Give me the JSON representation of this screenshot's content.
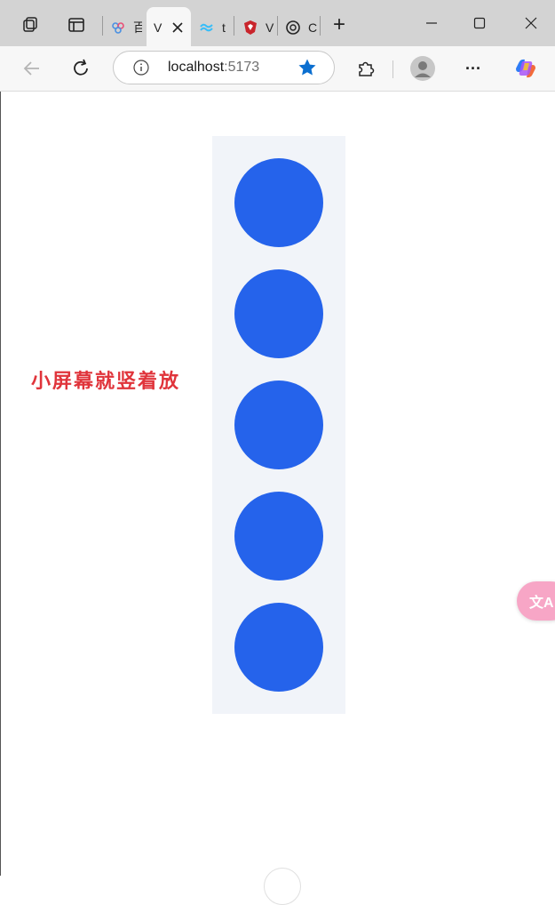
{
  "browser": {
    "tabs": [
      {
        "title": "百"
      },
      {
        "title": "V"
      },
      {
        "title": "t"
      },
      {
        "title": "V"
      },
      {
        "title": "C"
      }
    ],
    "new_tab_symbol": "+",
    "address": {
      "host": "localhost",
      "port": ":5173"
    },
    "more_symbol": "···"
  },
  "page": {
    "caption": "小屏幕就竖着放",
    "circle_count": 5,
    "circle_color": "#2563eb",
    "caption_color": "#e0343b",
    "translate_label": "文A"
  }
}
